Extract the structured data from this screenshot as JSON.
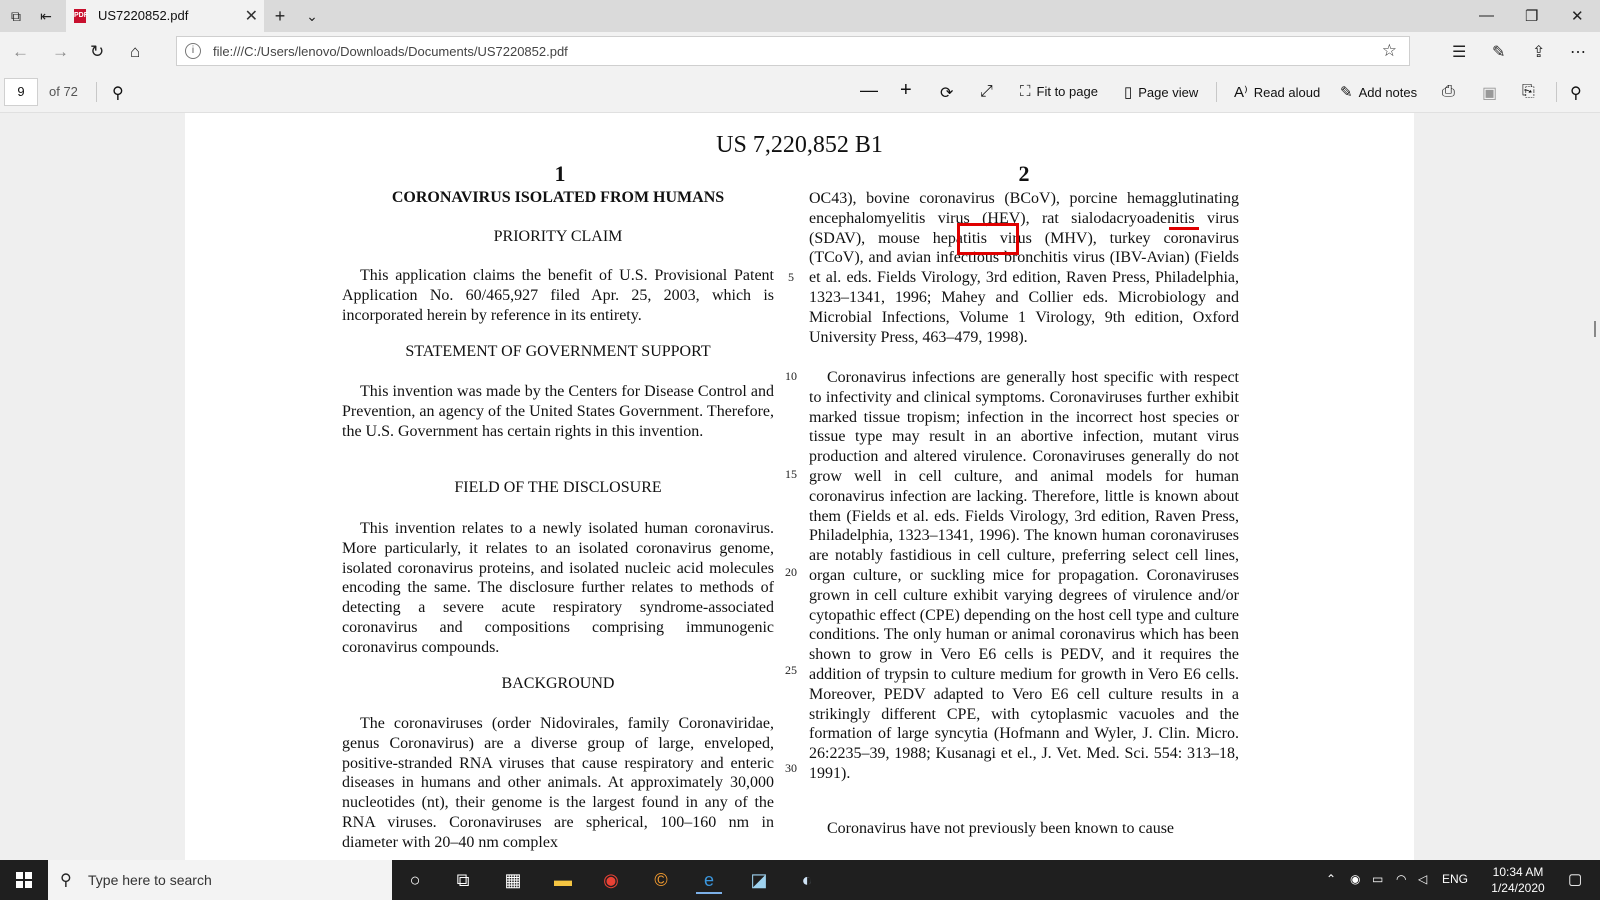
{
  "browser": {
    "tab_title": "US7220852.pdf",
    "pdf_badge": "PDF",
    "url": "file:///C:/Users/lenovo/Downloads/Documents/US7220852.pdf"
  },
  "pdf_toolbar": {
    "current_page": "9",
    "of_pages": "of 72",
    "fit_to_page": "Fit to page",
    "page_view": "Page view",
    "read_aloud": "Read aloud",
    "add_notes": "Add notes"
  },
  "document": {
    "patent_number": "US 7,220,852 B1",
    "col1_number": "1",
    "col2_number": "2",
    "col1_title": "CORONAVIRUS ISOLATED FROM HUMANS",
    "h_priority": "PRIORITY CLAIM",
    "p_priority": "This application claims the benefit of U.S. Provisional Patent Application No. 60/465,927 filed Apr. 25, 2003, which is incorporated herein by reference in its entirety.",
    "h_gov": "STATEMENT OF GOVERNMENT SUPPORT",
    "p_gov": "This invention was made by the Centers for Disease Control and Prevention, an agency of the United States Government. Therefore, the U.S. Government has certain rights in this invention.",
    "h_field": "FIELD OF THE DISCLOSURE",
    "p_field": "This invention relates to a newly isolated human coronavirus. More particularly, it relates to an isolated coronavirus genome, isolated coronavirus proteins, and isolated nucleic acid molecules encoding the same. The disclosure further relates to methods of detecting a severe acute respiratory syndrome-associated coronavirus and compositions comprising immunogenic coronavirus compounds.",
    "h_background": "BACKGROUND",
    "p_background": "The coronaviruses (order Nidovirales, family Coronaviridae, genus Coronavirus) are a diverse group of large, enveloped, positive-stranded RNA viruses that cause respiratory and enteric diseases in humans and other animals. At approximately 30,000 nucleotides (nt), their genome is the largest found in any of the RNA viruses. Coronaviruses are spherical, 100–160 nm in diameter with 20–40 nm complex",
    "col2_p1": "OC43), bovine coronavirus (BCoV), porcine hemagglutinating encephalomyelitis virus (HEV), rat sialodacryoadenitis virus (SDAV), mouse hepatitis virus (MHV), turkey coronavirus (TCoV), and avian infectious bronchitis virus (IBV-Avian) (Fields et al. eds. Fields Virology, 3rd edition, Raven Press, Philadelphia, 1323–1341, 1996; Mahey and Collier eds. Microbiology and Microbial Infections, Volume 1 Virology, 9th edition, Oxford University Press, 463–479, 1998).",
    "col2_p2": "Coronavirus infections are generally host specific with respect to infectivity and clinical symptoms. Coronaviruses further exhibit marked tissue tropism; infection in the incorrect host species or tissue type may result in an abortive infection, mutant virus production and altered virulence. Coronaviruses generally do not grow well in cell culture, and animal models for human coronavirus infection are lacking. Therefore, little is known about them (Fields et al. eds. Fields Virology, 3rd edition, Raven Press, Philadelphia, 1323–1341, 1996). The known human coronaviruses are notably fastidious in cell culture, preferring select cell lines, organ culture, or suckling mice for propagation. Coronaviruses grown in cell culture exhibit varying degrees of virulence and/or cytopathic effect (CPE) depending on the host cell type and culture conditions. The only human or animal coronavirus which has been shown to grow in Vero E6 cells is PEDV, and it requires the addition of trypsin to culture medium for growth in Vero E6 cells. Moreover, PEDV adapted to Vero E6 cell culture results in a strikingly different CPE, with cytoplasmic vacuoles and the formation of large syncytia (Hofmann and Wyler, J. Clin. Micro. 26:2235–39, 1988; Kusanagi et el., J. Vet. Med. Sci. 554: 313–18, 1991).",
    "col2_p3": "Coronavirus have not previously been known to cause",
    "line_numbers": [
      "5",
      "10",
      "15",
      "20",
      "25",
      "30"
    ]
  },
  "taskbar": {
    "search_placeholder": "Type here to search",
    "language": "ENG",
    "time": "10:34 AM",
    "date": "1/24/2020"
  },
  "colors": {
    "annotation_red": "#e00000",
    "taskbar_bg": "#1f1f1f"
  }
}
